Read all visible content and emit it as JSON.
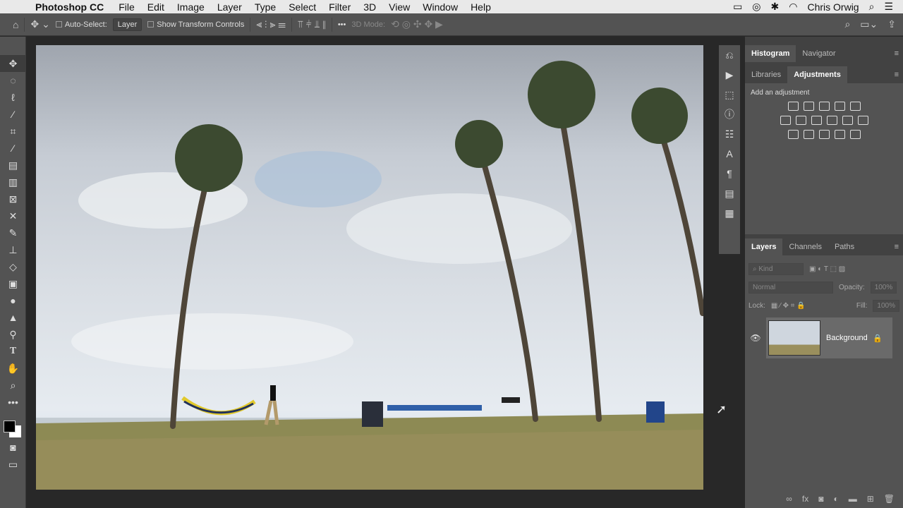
{
  "menubar": {
    "app": "Photoshop CC",
    "items": [
      "File",
      "Edit",
      "Image",
      "Layer",
      "Type",
      "Select",
      "Filter",
      "3D",
      "View",
      "Window",
      "Help"
    ],
    "user": "Chris Orwig"
  },
  "options": {
    "auto_select": "Auto-Select:",
    "layer_select": "Layer",
    "show_transform": "Show Transform Controls",
    "more": "•••",
    "mode_3d": "3D Mode:"
  },
  "tools": [
    "move",
    "marquee",
    "lasso",
    "quick-select",
    "crop",
    "eyedropper",
    "healing",
    "brush-patch",
    "frame",
    "clone",
    "brush",
    "stamp",
    "eraser",
    "gradient",
    "blur",
    "sharpen",
    "dodge",
    "type",
    "hand",
    "zoom",
    "more"
  ],
  "panels": {
    "top_tabs": [
      "Histogram",
      "Navigator"
    ],
    "mid_tabs": [
      "Libraries",
      "Adjustments"
    ],
    "add_adjustment": "Add an adjustment",
    "layer_tabs": [
      "Layers",
      "Channels",
      "Paths"
    ],
    "kind": "Kind",
    "blend_mode": "Normal",
    "opacity_label": "Opacity:",
    "opacity": "100%",
    "lock_label": "Lock:",
    "fill_label": "Fill:",
    "fill": "100%",
    "layers": [
      {
        "name": "Background",
        "visible": true,
        "locked": true
      }
    ]
  }
}
